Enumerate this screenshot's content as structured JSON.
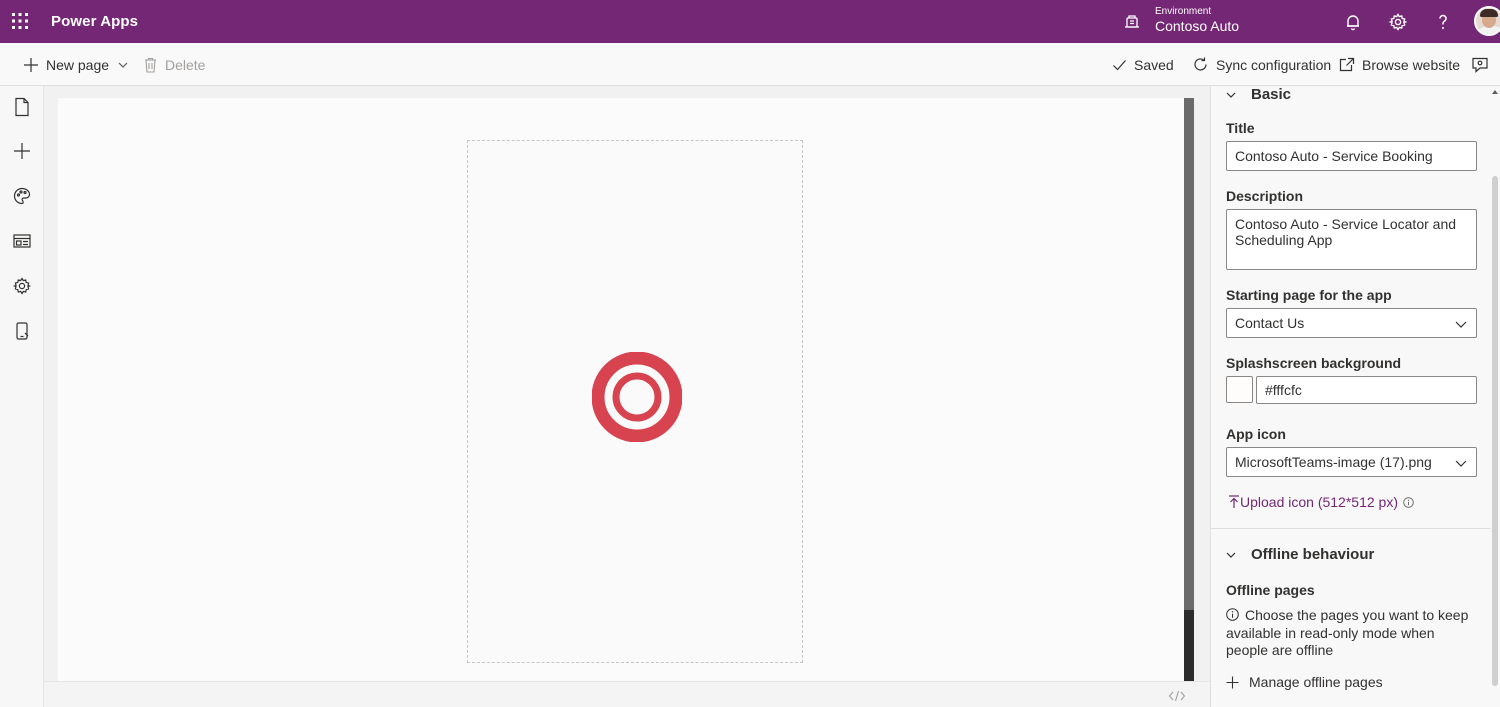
{
  "header": {
    "app_name": "Power Apps",
    "environment_label": "Environment",
    "environment_name": "Contoso Auto",
    "brand_color": "#742774"
  },
  "commandbar": {
    "new_page": "New page",
    "delete": "Delete",
    "saved": "Saved",
    "sync": "Sync configuration",
    "browse": "Browse website"
  },
  "left_rail": {
    "items": [
      "pages-icon",
      "add-icon",
      "theme-icon",
      "data-icon",
      "settings-icon",
      "mobile-icon"
    ]
  },
  "panel": {
    "basic_section": "Basic",
    "title_label": "Title",
    "title_value": "Contoso Auto - Service Booking",
    "description_label": "Description",
    "description_value": "Contoso Auto - Service Locator and Scheduling App",
    "starting_page_label": "Starting page for the app",
    "starting_page_value": "Contact Us",
    "splash_label": "Splashscreen background",
    "splash_value": "#fffcfc",
    "app_icon_label": "App icon",
    "app_icon_value": "MicrosoftTeams-image (17).png",
    "upload_label": "Upload icon (512*512 px)",
    "offline_section": "Offline behaviour",
    "offline_pages_label": "Offline pages",
    "offline_description": "Choose the pages you want to keep available in read-only mode when people are offline",
    "manage_offline": "Manage offline pages"
  },
  "canvas": {
    "logo_color": "#d7434f"
  }
}
